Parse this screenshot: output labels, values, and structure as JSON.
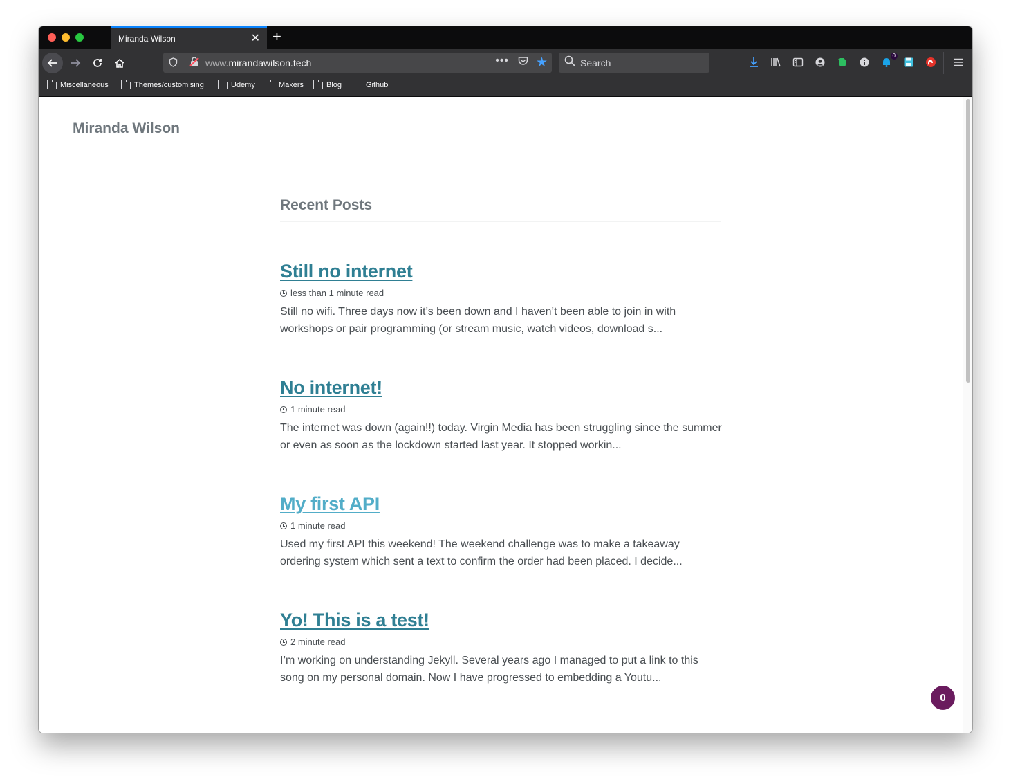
{
  "browser": {
    "tab_title": "Miranda Wilson",
    "tab_close": "✕",
    "new_tab": "+",
    "url_prefix": "www.",
    "url_domain": "mirandawilson.tech",
    "search_placeholder": "Search",
    "extension_badge": "0",
    "accent_color": "#0a84ff"
  },
  "bookmarks": [
    {
      "label": "Miscellaneous"
    },
    {
      "label": "Themes/customising"
    },
    {
      "label": "Udemy"
    },
    {
      "label": "Makers"
    },
    {
      "label": "Blog"
    },
    {
      "label": "Github"
    }
  ],
  "site": {
    "title": "Miranda Wilson",
    "section_title": "Recent Posts",
    "link_color": "#2f7f93"
  },
  "posts": [
    {
      "title": "Still no internet",
      "read_time": "less than 1 minute read",
      "excerpt": "Still no wifi. Three days now it’s been down and I haven’t been able to join in with workshops or pair programming (or stream music, watch videos, download s..."
    },
    {
      "title": "No internet!",
      "read_time": "1 minute read",
      "excerpt": "The internet was down (again!!) today. Virgin Media has been struggling since the summer or even as soon as the lockdown started last year. It stopped workin..."
    },
    {
      "title": "My first API",
      "read_time": "1 minute read",
      "excerpt": "Used my first API this weekend! The weekend challenge was to make a takeaway ordering system which sent a text to confirm the order had been placed. I decide..."
    },
    {
      "title": "Yo! This is a test!",
      "read_time": "2 minute read",
      "excerpt": "I’m working on understanding Jekyll. Several years ago I managed to put a link to this song on my personal domain. Now I have progressed to embedding a Youtu..."
    }
  ],
  "widget": {
    "count": "0",
    "color": "#6a1b5e"
  }
}
